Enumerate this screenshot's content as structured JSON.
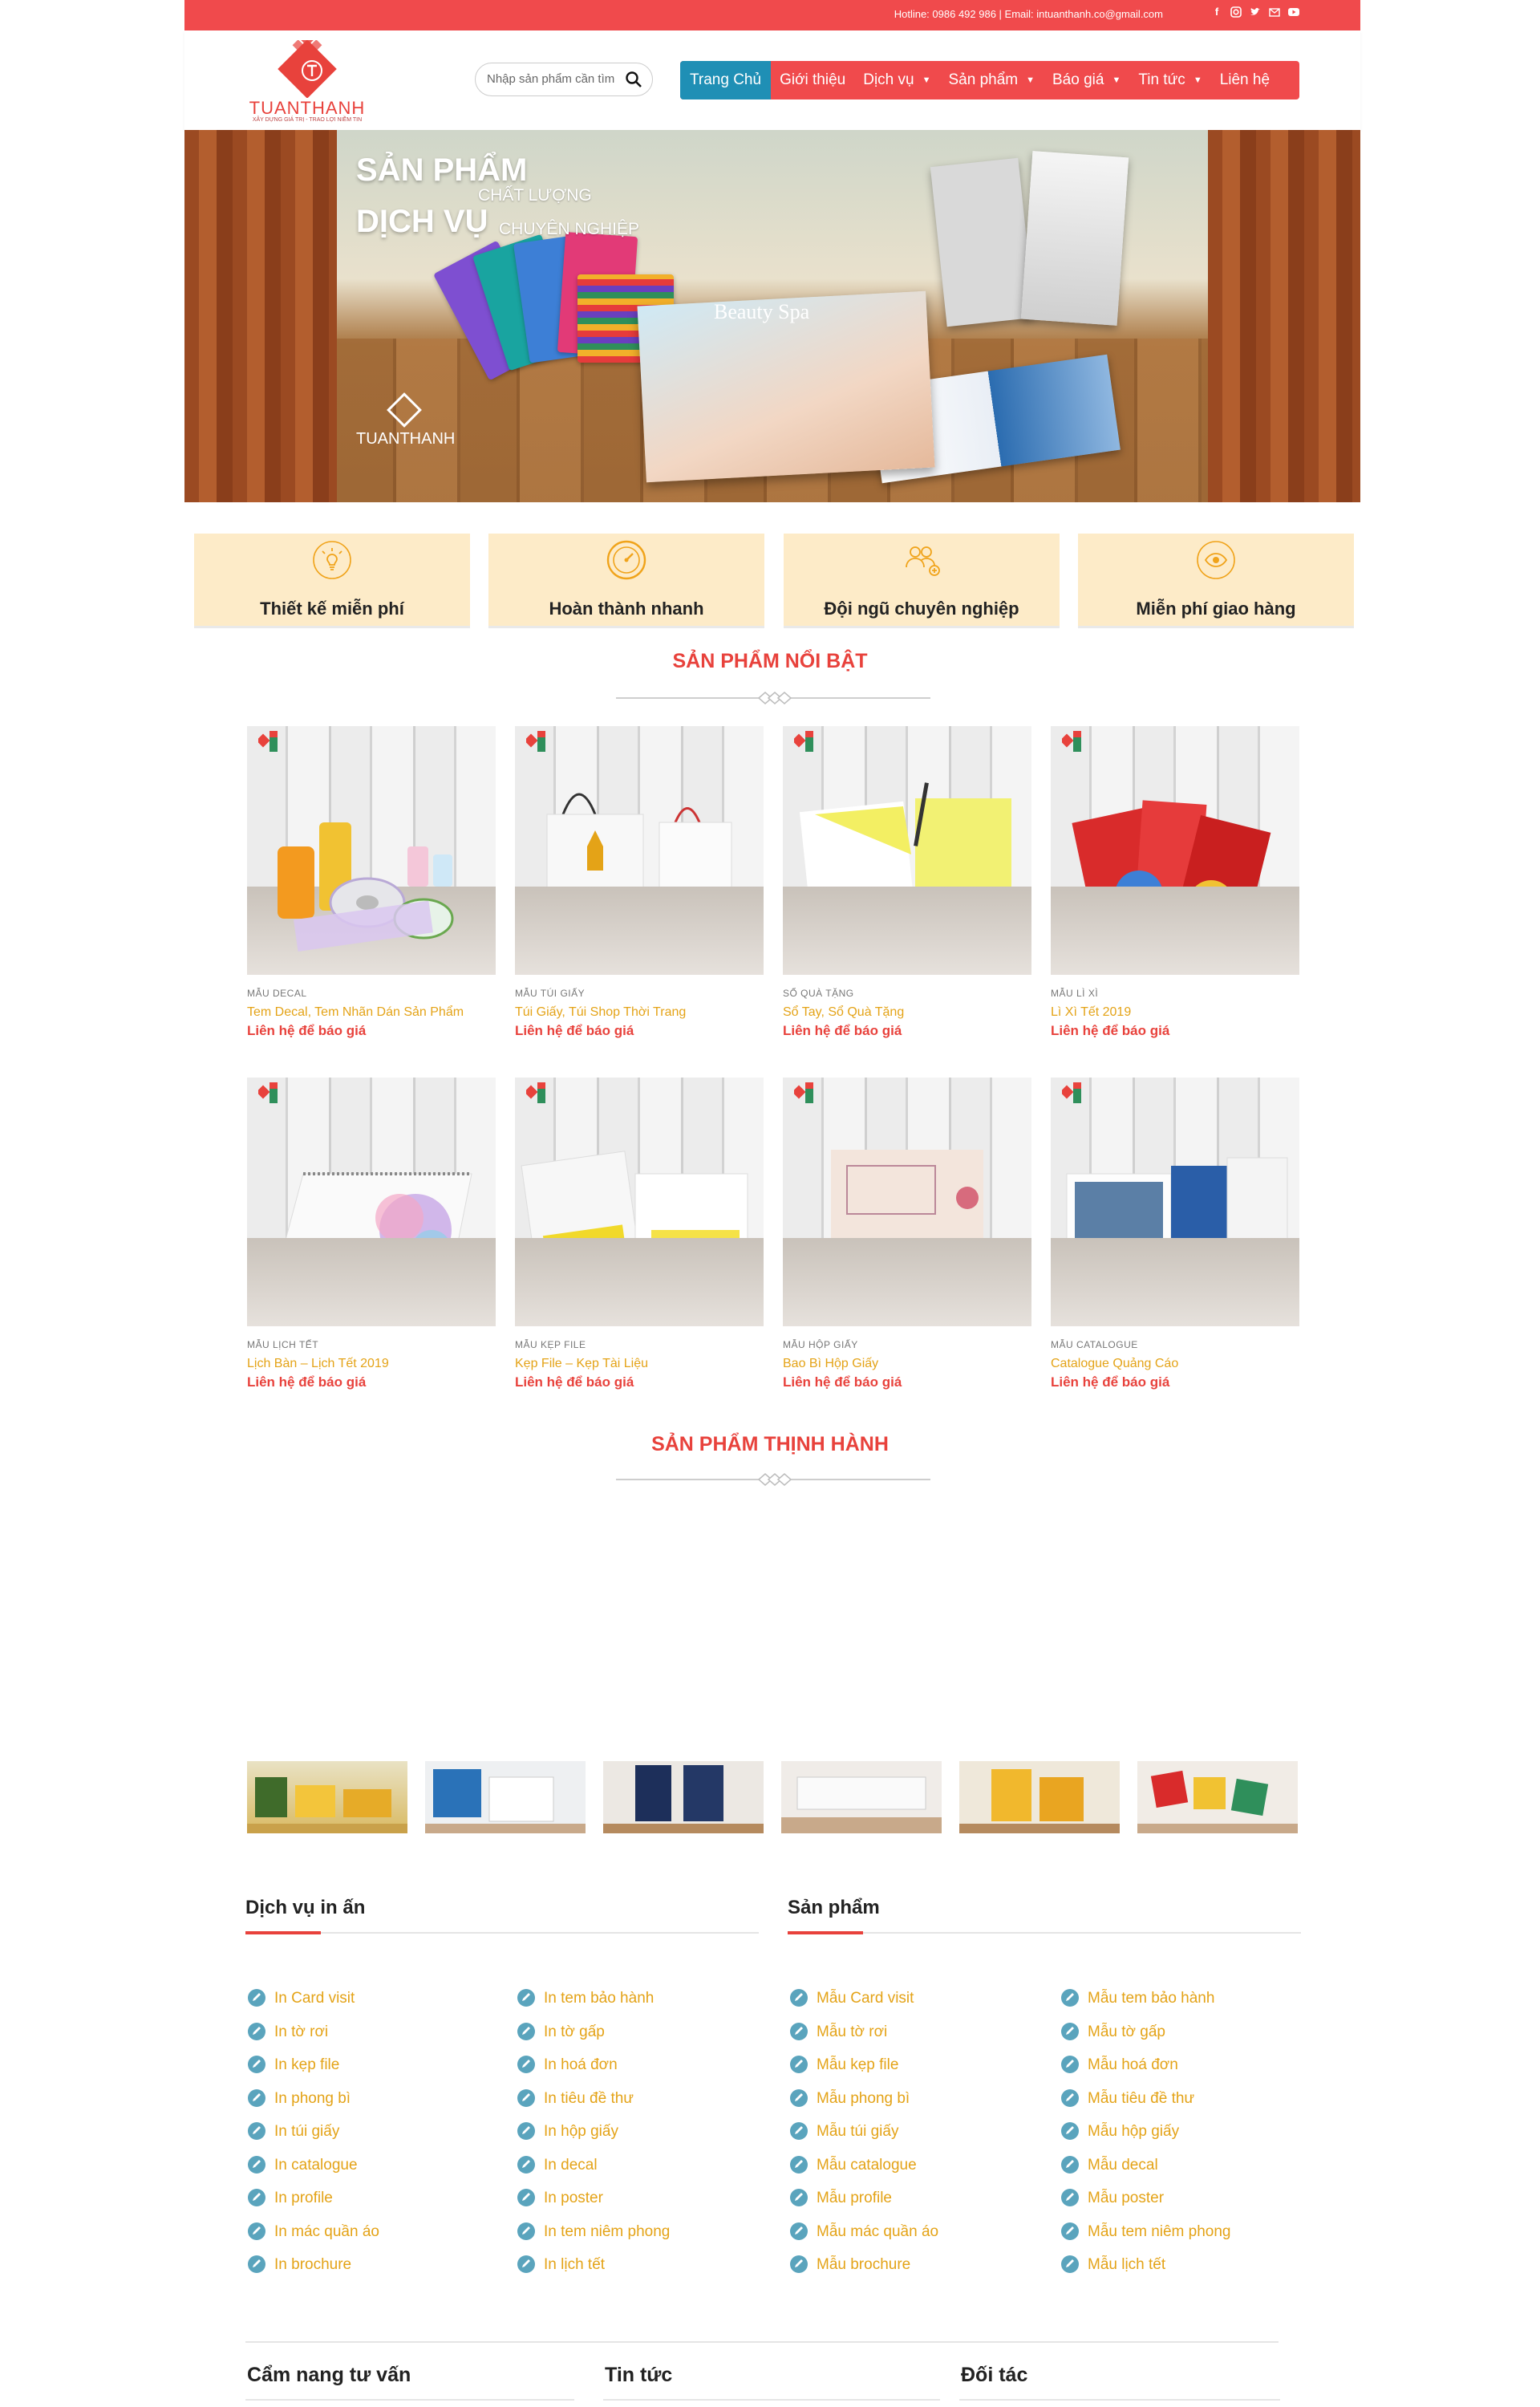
{
  "topbar": {
    "info": "Hotline: 0986 492 986 | Email: intuanthanh.co@gmail.com",
    "socials": [
      "facebook-icon",
      "instagram-icon",
      "twitter-icon",
      "mail-icon",
      "youtube-icon"
    ]
  },
  "header": {
    "logo_text": "TUANTHANH",
    "logo_sub": "XÂY DỰNG GIÁ TRỊ - TRAO LỢI NIỀM TIN",
    "search_placeholder": "Nhập sản phẩm cần tìm",
    "nav": [
      {
        "label": "Trang Chủ",
        "dropdown": false
      },
      {
        "label": "Giới thiệu",
        "dropdown": false
      },
      {
        "label": "Dịch vụ",
        "dropdown": true
      },
      {
        "label": "Sản phẩm",
        "dropdown": true
      },
      {
        "label": "Báo giá",
        "dropdown": true
      },
      {
        "label": "Tin tức",
        "dropdown": true
      },
      {
        "label": "Liên hệ",
        "dropdown": false
      }
    ]
  },
  "banner": {
    "line1": "SẢN PHẨM",
    "line1_sub": "CHẤT LƯỢNG",
    "line2": "DỊCH VỤ",
    "line2_sub": "CHUYÊN NGHIỆP",
    "spa_text": "Beauty Spa",
    "logo_text": "TUANTHANH"
  },
  "features": [
    {
      "label": "Thiết kế miễn phí",
      "icon": "lightbulb-icon"
    },
    {
      "label": "Hoàn thành nhanh",
      "icon": "speedometer-icon"
    },
    {
      "label": "Đội ngũ chuyên nghiệp",
      "icon": "team-icon"
    },
    {
      "label": "Miễn phí giao hàng",
      "icon": "eye-icon"
    }
  ],
  "featured": {
    "title": "SẢN PHẨM NỔI BẬT",
    "products": [
      {
        "category": "MẪU DECAL",
        "name": "Tem Decal, Tem Nhãn Dán Sản Phẩm",
        "price": "Liên hệ để báo giá"
      },
      {
        "category": "MẪU TÚI GIẤY",
        "name": "Túi Giấy, Túi Shop Thời Trang",
        "price": "Liên hệ để báo giá"
      },
      {
        "category": "SỔ QUÀ TẶNG",
        "name": "Sổ Tay, Sổ Quà Tặng",
        "price": "Liên hệ để báo giá"
      },
      {
        "category": "MẪU LÌ XÌ",
        "name": "Lì Xì Tết 2019",
        "price": "Liên hệ để báo giá"
      },
      {
        "category": "MẪU LỊCH TẾT",
        "name": "Lịch Bàn – Lịch Tết 2019",
        "price": "Liên hệ để báo giá"
      },
      {
        "category": "MẪU KẸP FILE",
        "name": "Kẹp File – Kẹp Tài Liệu",
        "price": "Liên hệ để báo giá"
      },
      {
        "category": "MẪU HỘP GIẤY",
        "name": "Bao Bì Hộp Giấy",
        "price": "Liên hệ để báo giá"
      },
      {
        "category": "MẪU CATALOGUE",
        "name": "Catalogue Quảng Cáo",
        "price": "Liên hệ để báo giá"
      }
    ]
  },
  "trending": {
    "title": "SẢN PHẨM THỊNH HÀNH"
  },
  "footer": {
    "services": {
      "title": "Dịch vụ in ấn",
      "col1": [
        "In Card visit",
        "In tờ rơi",
        "In kẹp file",
        "In phong bì",
        "In túi giấy",
        "In catalogue",
        "In profile",
        "In mác quần áo",
        "In brochure"
      ],
      "col2": [
        "In tem bảo hành",
        "In tờ gấp",
        "In hoá đơn",
        "In tiêu đề thư",
        "In hộp giấy",
        "In decal",
        "In poster",
        "In tem niêm phong",
        "In lịch tết"
      ]
    },
    "products": {
      "title": "Sản phẩm",
      "col1": [
        "Mẫu Card visit",
        "Mẫu tờ rơi",
        "Mẫu kẹp file",
        "Mẫu phong bì",
        "Mẫu túi giấy",
        "Mẫu catalogue",
        "Mẫu profile",
        "Mẫu mác quần áo",
        "Mẫu brochure"
      ],
      "col2": [
        "Mẫu tem bảo hành",
        "Mẫu tờ gấp",
        "Mẫu hoá đơn",
        "Mẫu tiêu đề thư",
        "Mẫu hộp giấy",
        "Mẫu decal",
        "Mẫu poster",
        "Mẫu tem niêm phong",
        "Mẫu lịch tết"
      ]
    },
    "bottom": [
      "Cẩm nang tư vấn",
      "Tin tức",
      "Đối tác"
    ]
  },
  "colors": {
    "brand": "#f04a4c",
    "accent": "#1f8fb5",
    "link": "#e4a317",
    "feature_bg": "#fdebc8"
  }
}
